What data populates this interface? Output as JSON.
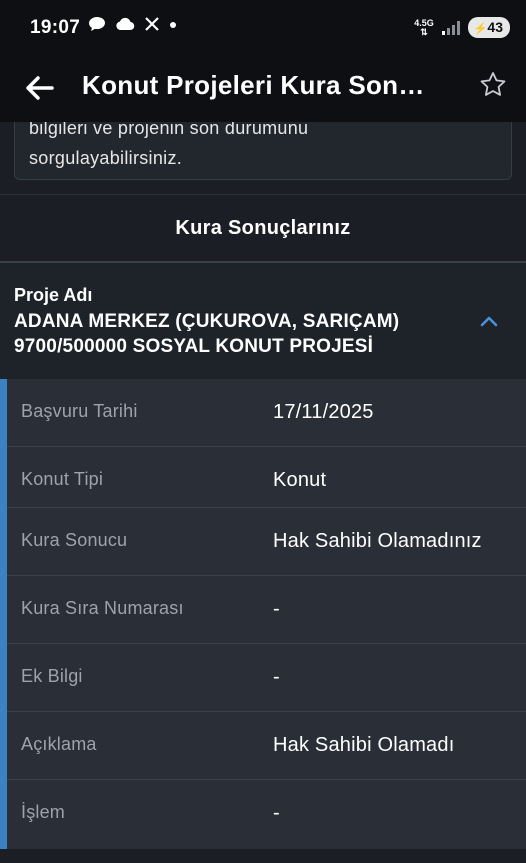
{
  "status_bar": {
    "time": "19:07",
    "network": "4.5G",
    "battery": "43",
    "notification_icons": [
      "chat-icon",
      "cloud-icon",
      "x-icon",
      "dot-icon"
    ]
  },
  "app_bar": {
    "title": "Konut Projeleri Kura Son…"
  },
  "info_card": {
    "line1": "bilgileri ve projenin son durumunu",
    "line2": "sorgulayabilirsiniz."
  },
  "section": {
    "title": "Kura Sonuçlarınız"
  },
  "project": {
    "label": "Proje Adı",
    "name_line1": "ADANA MERKEZ (ÇUKUROVA, SARIÇAM)",
    "name_line2": "9700/500000 SOSYAL KONUT PROJESİ"
  },
  "details": [
    {
      "label": "Başvuru Tarihi",
      "value": "17/11/2025"
    },
    {
      "label": "Konut Tipi",
      "value": "Konut"
    },
    {
      "label": "Kura Sonucu",
      "value": "Hak Sahibi Olamadınız"
    },
    {
      "label": "Kura Sıra Numarası",
      "value": "-"
    },
    {
      "label": "Ek Bilgi",
      "value": "-"
    },
    {
      "label": "Açıklama",
      "value": "Hak Sahibi Olamadı"
    },
    {
      "label": "İşlem",
      "value": "-"
    }
  ],
  "colors": {
    "accent": "#3b82c4",
    "background": "#1b1f25",
    "toolbar": "#0d0f12"
  }
}
